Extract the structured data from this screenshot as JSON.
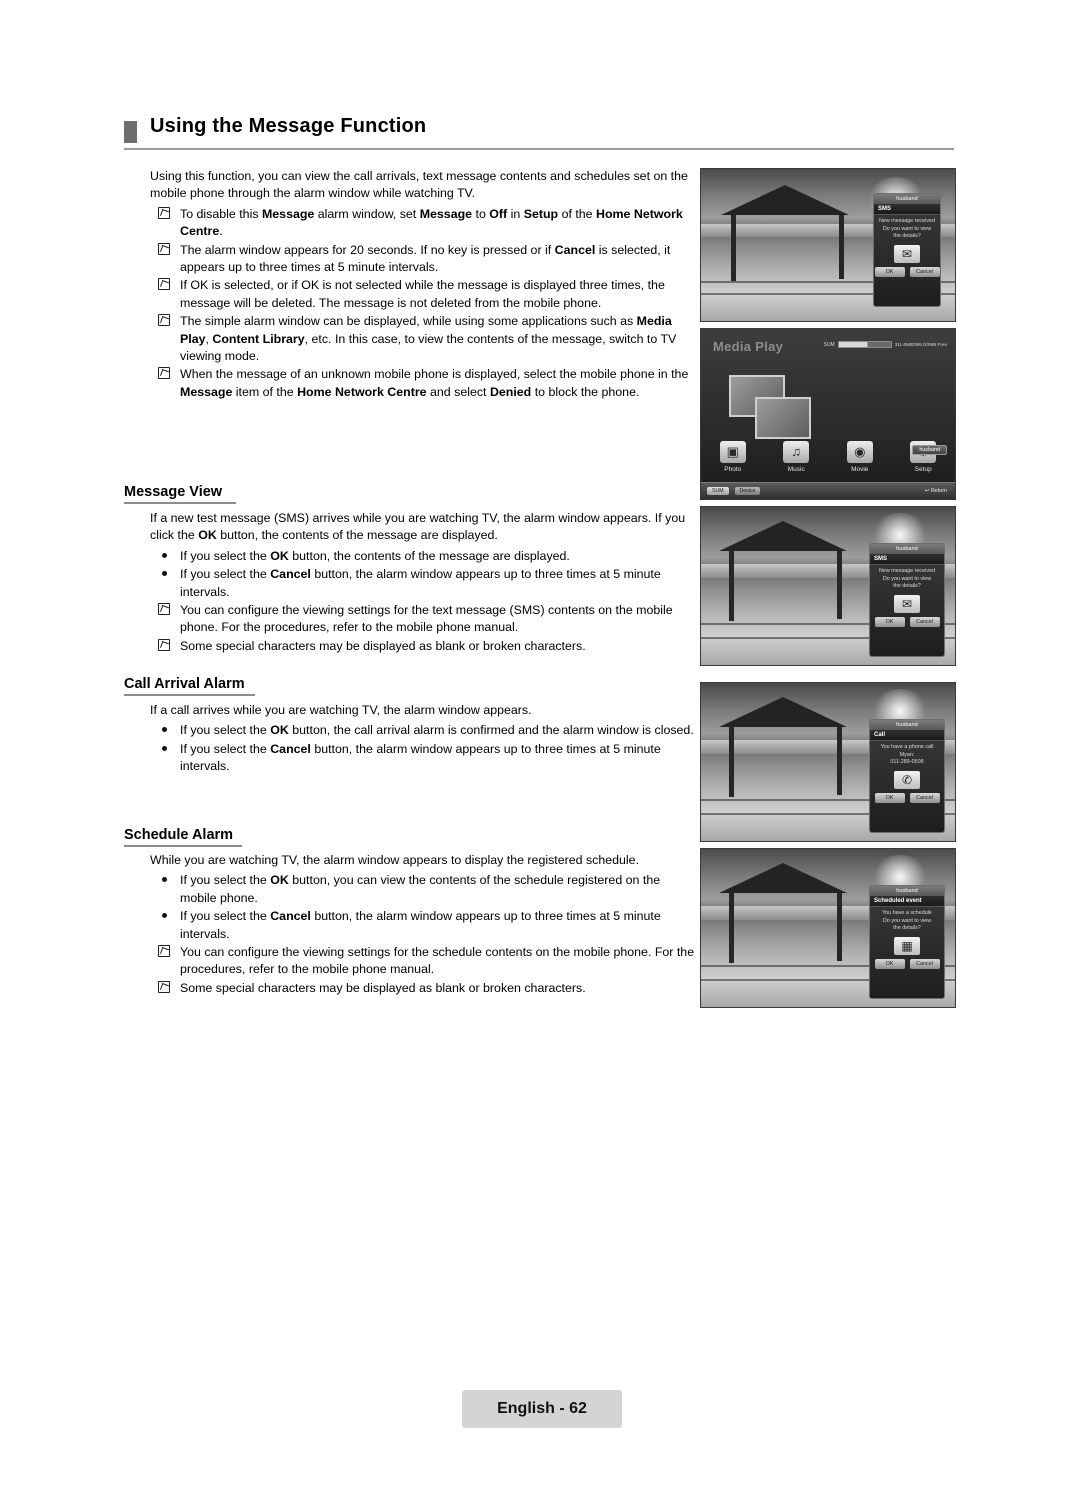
{
  "page": {
    "title": "Using the Message Function",
    "footer_label": "English - 62"
  },
  "intro": {
    "paragraph": "Using this function, you can view the call arrivals, text message contents and schedules set on the mobile phone through the alarm window while watching TV.",
    "notes": [
      "To disable this Message alarm window, set Message to Off in Setup of the Home Network Centre.",
      "The alarm window appears for 20 seconds. If no key is pressed or if Cancel is selected, it appears up to three times at 5 minute intervals.",
      "If OK is selected, or if OK is not selected while the message is displayed three times, the message will be deleted. The message is not deleted from the mobile phone.",
      "The simple alarm window can be displayed, while using some applications such as Media Play, Content Library, etc. In this case, to view the contents of the message, switch to TV viewing mode.",
      "When the message of an unknown mobile phone is displayed, select the mobile phone in the Message item of the Home Network Centre and select Denied to block the phone."
    ]
  },
  "sections": [
    {
      "heading": "Message View",
      "paragraph": "If a new test message (SMS) arrives while you are watching TV, the alarm window appears. If you click the OK button, the contents of the message are displayed.",
      "dots": [
        "If you select the OK button, the contents of the message are displayed.",
        "If you select the Cancel button, the alarm window appears up to three times at 5 minute intervals."
      ],
      "notes": [
        "You can configure the viewing settings for the text message (SMS) contents on the mobile phone. For the procedures, refer to the mobile phone manual.",
        "Some special characters may be displayed as blank or broken characters."
      ]
    },
    {
      "heading": "Call Arrival Alarm",
      "paragraph": "If a call arrives while you are watching TV, the alarm window appears.",
      "dots": [
        "If you select the OK button, the call arrival alarm is confirmed and the alarm window is closed.",
        "If you select the Cancel button, the alarm window appears up to three times at 5 minute intervals."
      ],
      "notes": []
    },
    {
      "heading": "Schedule Alarm",
      "paragraph": "While you are watching TV, the alarm window appears to display the registered schedule.",
      "dots": [
        "If you select the OK button, you can view the contents of the schedule registered on the mobile phone.",
        "If you select the Cancel button, the alarm window appears up to three times at 5 minute intervals."
      ],
      "notes": [
        "You can configure the viewing settings for the schedule contents on the mobile phone. For the procedures, refer to the mobile phone manual.",
        "Some special characters may be displayed as blank or broken characters."
      ]
    }
  ],
  "screenshots": {
    "sms_small": {
      "sender": "husband",
      "type": "SMS",
      "line1": "New message received",
      "line2": "Do you want to view",
      "line3": "the details?",
      "icon": "envelope-icon",
      "ok": "OK",
      "cancel": "Cancel"
    },
    "media_play": {
      "title": "Media Play",
      "device_label": "SUM",
      "capacity": "311.6MB/399.0/2MB Free",
      "items": [
        "Photo",
        "Music",
        "Movie",
        "Setup"
      ],
      "selection_badge": "husband",
      "foot_device_key": "SUM",
      "foot_device_label": "Device",
      "foot_return": "Return"
    },
    "sms_large": {
      "sender": "husband",
      "type": "SMS",
      "line1": "New message received",
      "line2": "Do you want to view",
      "line3": "the details?",
      "icon": "envelope-icon",
      "ok": "OK",
      "cancel": "Cancel"
    },
    "call": {
      "sender": "husband",
      "type": "Call",
      "line1": "You have a phone call",
      "line2": "Myan:",
      "line3": "011-289-0508",
      "icon": "phone-icon",
      "ok": "OK",
      "cancel": "Cancel"
    },
    "schedule": {
      "sender": "husband",
      "type": "Scheduled event",
      "line1": "You have a schedule",
      "line2": "Do you want to view",
      "line3": "the details?",
      "icon": "calendar-icon",
      "ok": "OK",
      "cancel": "Cancel"
    }
  }
}
